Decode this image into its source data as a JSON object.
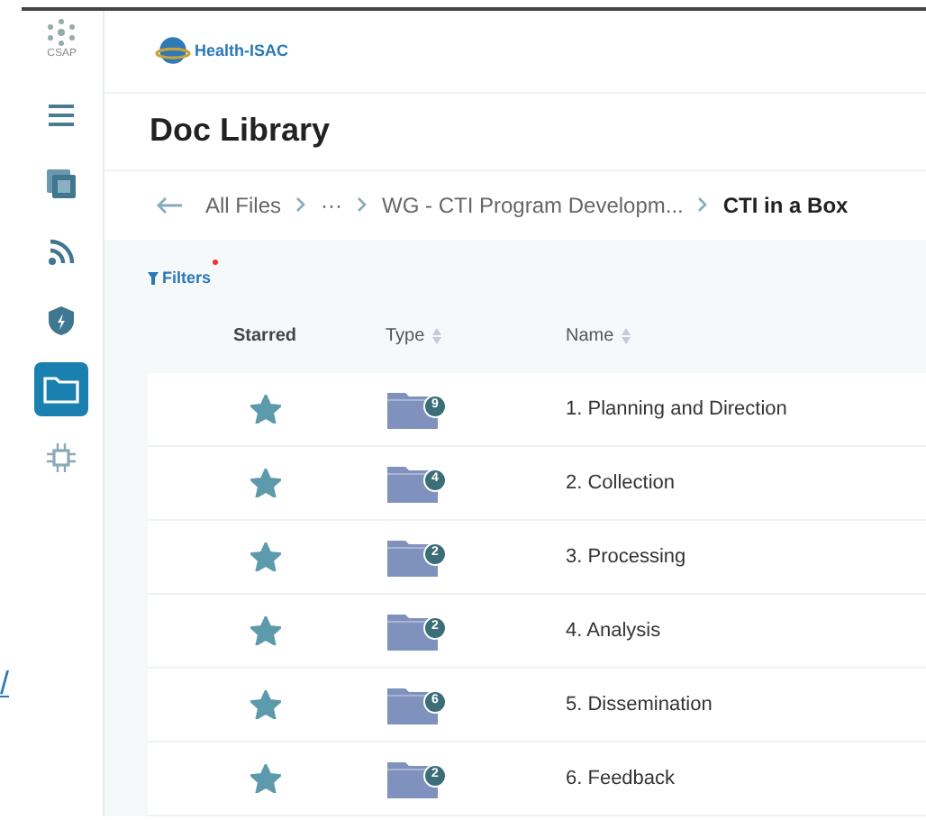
{
  "sidebar": {
    "app_label": "CSAP",
    "items": [
      {
        "kind": "menu",
        "selected": false
      },
      {
        "kind": "layers",
        "selected": false
      },
      {
        "kind": "feed",
        "selected": false
      },
      {
        "kind": "shield",
        "selected": false
      },
      {
        "kind": "folder",
        "selected": true
      },
      {
        "kind": "chip",
        "selected": false
      }
    ]
  },
  "link_fragment": "/",
  "header": {
    "logo_text": "Health-ISAC"
  },
  "page_title": "Doc Library",
  "breadcrumb": [
    {
      "label": "All Files",
      "current": false
    },
    {
      "label": "···",
      "current": false
    },
    {
      "label": "WG - CTI Program Developm...",
      "current": false
    },
    {
      "label": "CTI in a Box",
      "current": true
    }
  ],
  "filters": {
    "label": "Filters",
    "active": true
  },
  "table": {
    "columns": [
      {
        "label": "Starred",
        "sortable": false
      },
      {
        "label": "Type",
        "sortable": true
      },
      {
        "label": "Name",
        "sortable": true
      }
    ],
    "rows": [
      {
        "starred": true,
        "count": "9",
        "name": "1. Planning and Direction"
      },
      {
        "starred": true,
        "count": "4",
        "name": "2. Collection"
      },
      {
        "starred": true,
        "count": "2",
        "name": "3. Processing"
      },
      {
        "starred": true,
        "count": "2",
        "name": "4. Analysis"
      },
      {
        "starred": true,
        "count": "6",
        "name": "5. Dissemination"
      },
      {
        "starred": true,
        "count": "2",
        "name": "6. Feedback"
      }
    ]
  }
}
